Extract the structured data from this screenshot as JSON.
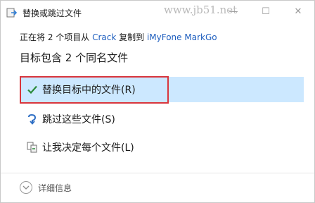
{
  "window": {
    "title": "替换或跳过文件",
    "watermark": "www.jb51.net",
    "minimize_glyph": "—",
    "maximize_glyph": "☐",
    "close_glyph": "✕"
  },
  "copy": {
    "prefix": "正在将 2 个项目从 ",
    "source": "Crack",
    "middle": " 复制到 ",
    "destination": "iMyFone MarkGo"
  },
  "headline": "目标包含 2 个同名文件",
  "options": {
    "replace": {
      "label": "替换目标中的文件(R)",
      "icon": "check-icon"
    },
    "skip": {
      "label": "跳过这些文件(S)",
      "icon": "skip-arrow-icon"
    },
    "decide": {
      "label": "让我决定每个文件(L)",
      "icon": "file-compare-icon"
    }
  },
  "details": {
    "label": "详细信息",
    "icon": "chevron-down-icon"
  },
  "colors": {
    "selected_bg": "#cce8ff",
    "highlight_border": "#d9353c",
    "link": "#1f5fbf",
    "check": "#2a8a3a"
  }
}
